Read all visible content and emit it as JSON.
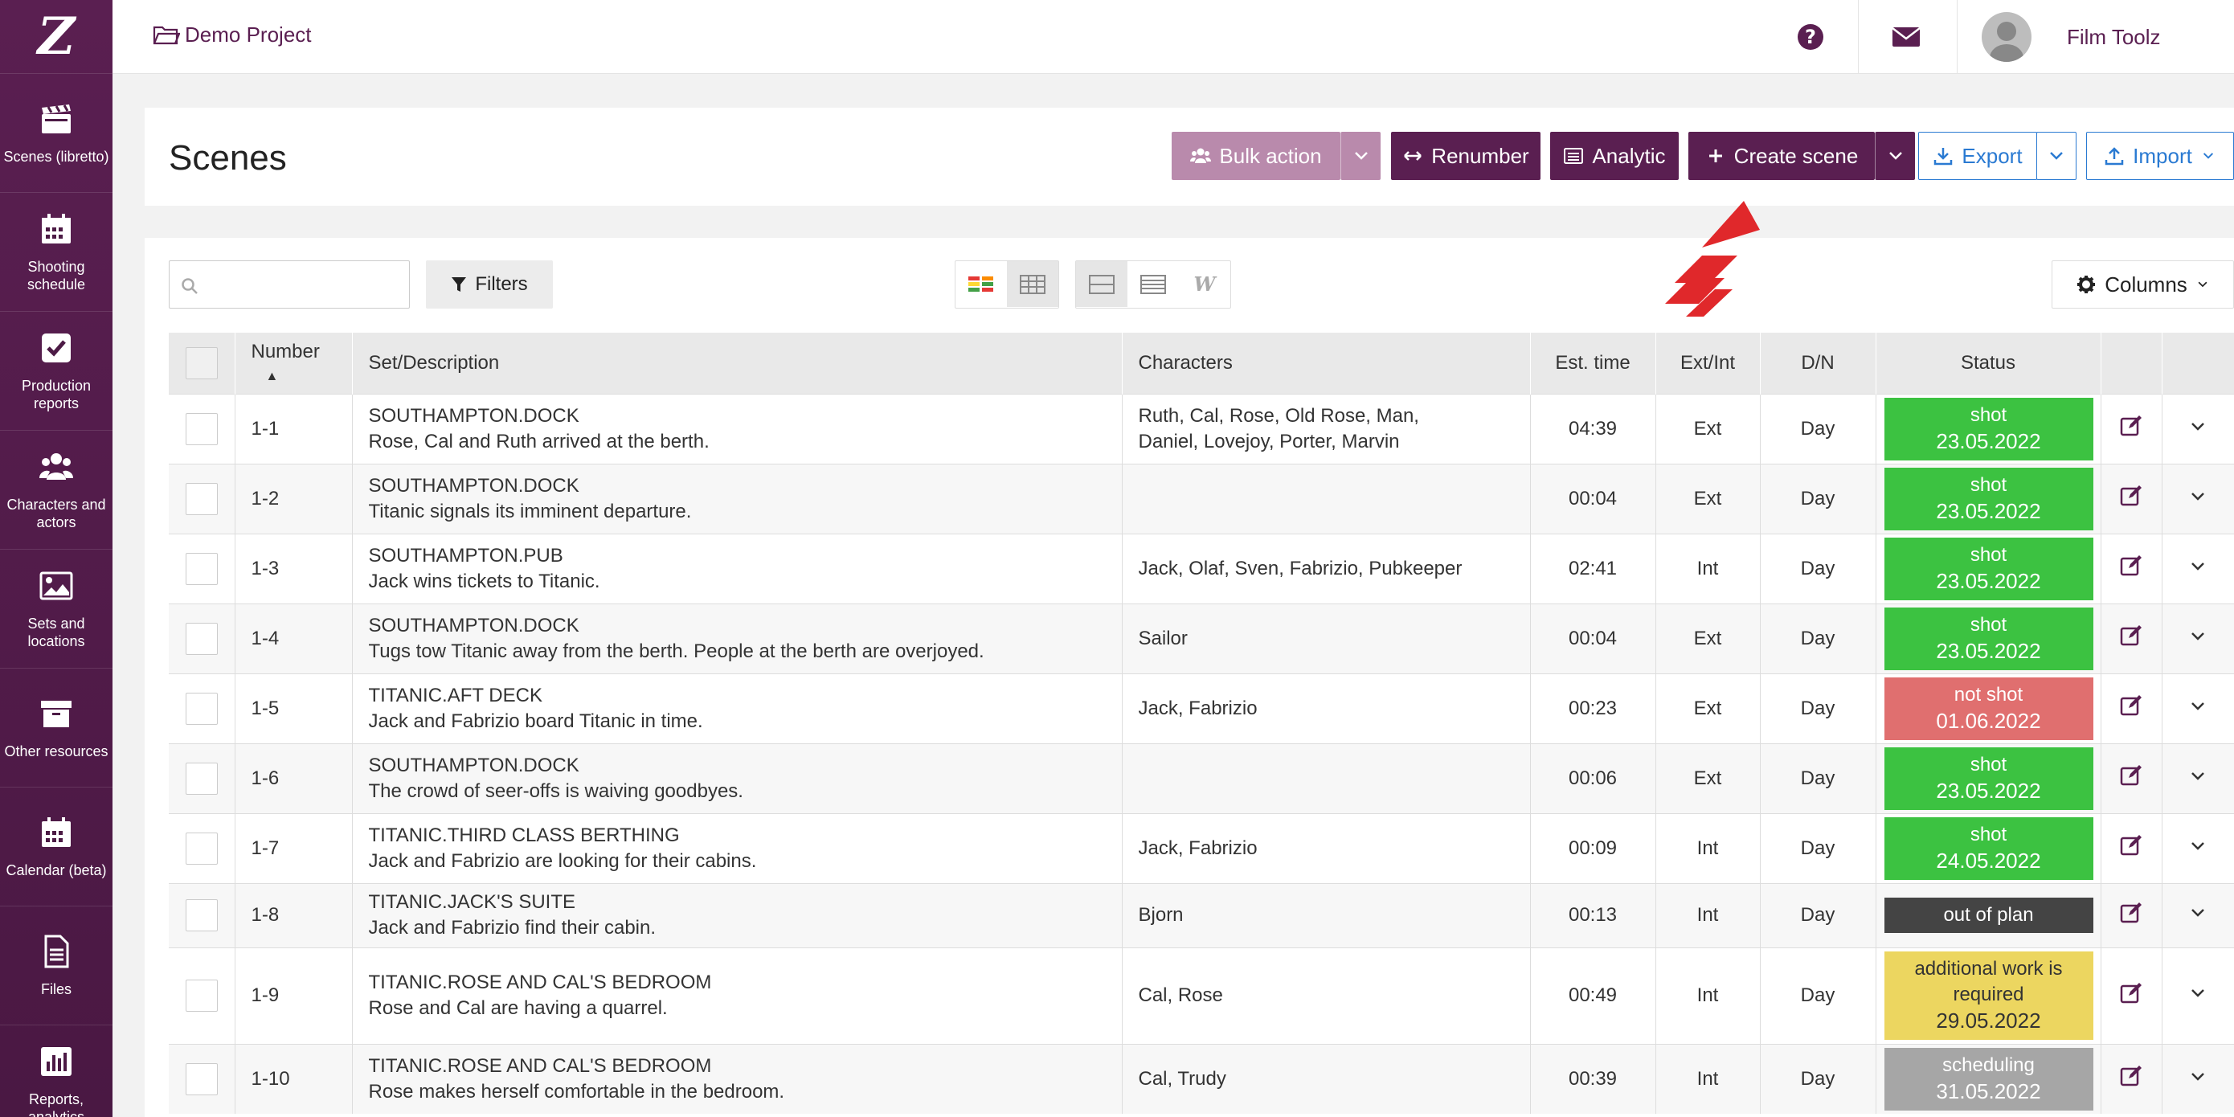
{
  "sidebar": {
    "logo": "Z",
    "items": [
      {
        "label": "Scenes (libretto)",
        "icon": "clapperboard-icon"
      },
      {
        "label": "Shooting schedule",
        "icon": "calendar-icon"
      },
      {
        "label": "Production reports",
        "icon": "check-square-icon"
      },
      {
        "label": "Characters and actors",
        "icon": "users-icon"
      },
      {
        "label": "Sets and locations",
        "icon": "image-icon"
      },
      {
        "label": "Other resources",
        "icon": "archive-icon"
      },
      {
        "label": "Calendar (beta)",
        "icon": "calendar-icon"
      },
      {
        "label": "Files",
        "icon": "file-icon"
      },
      {
        "label": "Reports, analytics",
        "icon": "bar-chart-icon"
      }
    ]
  },
  "topbar": {
    "project": "Demo Project",
    "user_name": "Film Toolz"
  },
  "header": {
    "title": "Scenes",
    "bulk_action": "Bulk action",
    "renumber": "Renumber",
    "analytic": "Analytic",
    "create_scene": "Create scene",
    "export": "Export",
    "import": "Import"
  },
  "toolbar": {
    "search_placeholder": "",
    "filters": "Filters",
    "columns": "Columns"
  },
  "table": {
    "headers": {
      "number": "Number",
      "set": "Set/Description",
      "characters": "Characters",
      "est_time": "Est. time",
      "ext_int": "Ext/Int",
      "dn": "D/N",
      "status": "Status"
    },
    "rows": [
      {
        "number": "1-1",
        "set": "SOUTHAMPTON.DOCK",
        "desc": "Rose, Cal and Ruth arrived at the berth.",
        "chars1": "Ruth, Cal, Rose, Old Rose, Man,",
        "chars2": "Daniel, Lovejoy, Porter, Marvin",
        "time": "04:39",
        "ei": "Ext",
        "dn": "Day",
        "status": "shot",
        "status2": "",
        "date": "23.05.2022",
        "status_color": "#3cc241"
      },
      {
        "number": "1-2",
        "set": "SOUTHAMPTON.DOCK",
        "desc": "Titanic signals its imminent departure.",
        "chars1": "",
        "chars2": "",
        "time": "00:04",
        "ei": "Ext",
        "dn": "Day",
        "status": "shot",
        "status2": "",
        "date": "23.05.2022",
        "status_color": "#3cc241"
      },
      {
        "number": "1-3",
        "set": "SOUTHAMPTON.PUB",
        "desc": "Jack wins tickets to Titanic.",
        "chars1": "Jaсk, Olaf, Sven, Fabrizio, Pubkeeper",
        "chars2": "",
        "time": "02:41",
        "ei": "Int",
        "dn": "Day",
        "status": "shot",
        "status2": "",
        "date": "23.05.2022",
        "status_color": "#3cc241"
      },
      {
        "number": "1-4",
        "set": "SOUTHAMPTON.DOCK",
        "desc": "Tugs tow Titanic away from the berth. People at the berth are overjoyed.",
        "chars1": "Sailor",
        "chars2": "",
        "time": "00:04",
        "ei": "Ext",
        "dn": "Day",
        "status": "shot",
        "status2": "",
        "date": "23.05.2022",
        "status_color": "#3cc241"
      },
      {
        "number": "1-5",
        "set": "TITANIC.AFT DECK",
        "desc": "Jack and Fabrizio board Titanic in time.",
        "chars1": "Jaсk, Fabrizio",
        "chars2": "",
        "time": "00:23",
        "ei": "Ext",
        "dn": "Day",
        "status": "not shot",
        "status2": "",
        "date": "01.06.2022",
        "status_color": "#e06f6f"
      },
      {
        "number": "1-6",
        "set": "SOUTHAMPTON.DOCK",
        "desc": "The crowd of seer-offs is waiving goodbyes.",
        "chars1": "",
        "chars2": "",
        "time": "00:06",
        "ei": "Ext",
        "dn": "Day",
        "status": "shot",
        "status2": "",
        "date": "23.05.2022",
        "status_color": "#3cc241"
      },
      {
        "number": "1-7",
        "set": "TITANIC.THIRD CLASS BERTHING",
        "desc": "Jack and Fabrizio are looking for their cabins.",
        "chars1": "Jaсk, Fabrizio",
        "chars2": "",
        "time": "00:09",
        "ei": "Int",
        "dn": "Day",
        "status": "shot",
        "status2": "",
        "date": "24.05.2022",
        "status_color": "#3cc241"
      },
      {
        "number": "1-8",
        "set": "TITANIC.JACK'S SUITE",
        "desc": "Jack and Fabrizio find their cabin.",
        "chars1": "Bjorn",
        "chars2": "",
        "time": "00:13",
        "ei": "Int",
        "dn": "Day",
        "status": "out of plan",
        "status2": "",
        "date": "",
        "status_color": "#444444"
      },
      {
        "number": "1-9",
        "set": "TITANIC.ROSE AND CAL'S BEDROOM",
        "desc": "Rose and Cal are having a quarrel.",
        "chars1": "Cal, Rose",
        "chars2": "",
        "time": "00:49",
        "ei": "Int",
        "dn": "Day",
        "status": "additional work is",
        "status2": "required",
        "date": "29.05.2022",
        "status_color": "#ecd660"
      },
      {
        "number": "1-10",
        "set": "TITANIC.ROSE AND CAL'S BEDROOM",
        "desc": "Rose makes herself comfortable in the bedroom.",
        "chars1": "Cal, Trudy",
        "chars2": "",
        "time": "00:39",
        "ei": "Int",
        "dn": "Day",
        "status": "scheduling",
        "status2": "",
        "date": "31.05.2022",
        "status_color": "#a6a6a6"
      }
    ]
  },
  "colors": {
    "brand": "#5a1f51",
    "accent_blue": "#2a7ad2",
    "annotation_arrow": "#e0282b"
  }
}
